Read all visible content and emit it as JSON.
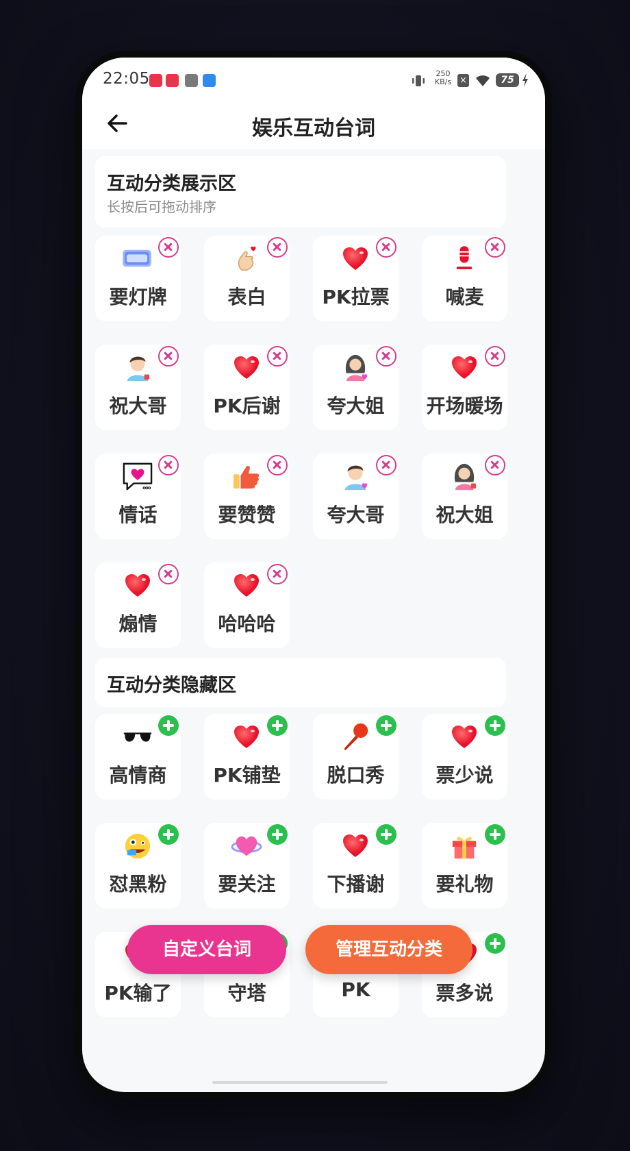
{
  "status_bar": {
    "time": "22:05",
    "net_speed_value": "250",
    "net_speed_unit": "KB/s",
    "battery": "75"
  },
  "header": {
    "title": "娱乐互动台词"
  },
  "shown_section": {
    "title": "互动分类展示区",
    "subtitle": "长按后可拖动排序",
    "items": [
      {
        "label": "要灯牌",
        "icon": "fan-club-badge-icon"
      },
      {
        "label": "表白",
        "icon": "finger-heart-icon"
      },
      {
        "label": "PK拉票",
        "icon": "heart-icon"
      },
      {
        "label": "喊麦",
        "icon": "microphone-icon"
      },
      {
        "label": "祝大哥",
        "icon": "man-thumbs-up-icon"
      },
      {
        "label": "PK后谢",
        "icon": "heart-icon"
      },
      {
        "label": "夸大姐",
        "icon": "woman-heart-icon"
      },
      {
        "label": "开场暖场",
        "icon": "heart-icon"
      },
      {
        "label": "情话",
        "icon": "heart-speech-bubble-icon"
      },
      {
        "label": "要赞赞",
        "icon": "thumbs-up-icon"
      },
      {
        "label": "夸大哥",
        "icon": "man-heart-icon"
      },
      {
        "label": "祝大姐",
        "icon": "woman-thumbs-up-icon"
      },
      {
        "label": "煽情",
        "icon": "heart-icon"
      },
      {
        "label": "哈哈哈",
        "icon": "heart-icon"
      }
    ]
  },
  "hidden_section": {
    "title": "互动分类隐藏区",
    "items": [
      {
        "label": "高情商",
        "icon": "sunglasses-icon"
      },
      {
        "label": "PK铺垫",
        "icon": "heart-icon"
      },
      {
        "label": "脱口秀",
        "icon": "karaoke-mic-icon"
      },
      {
        "label": "票少说",
        "icon": "heart-icon"
      },
      {
        "label": "怼黑粉",
        "icon": "crazy-face-icon"
      },
      {
        "label": "要关注",
        "icon": "heart-orbit-icon"
      },
      {
        "label": "下播谢",
        "icon": "heart-icon"
      },
      {
        "label": "要礼物",
        "icon": "gift-icon"
      },
      {
        "label": "PK输了",
        "icon": "heart-icon"
      },
      {
        "label": "守塔",
        "icon": "heart-icon"
      },
      {
        "label": "PK",
        "icon": "heart-icon"
      },
      {
        "label": "票多说",
        "icon": "heart-icon"
      }
    ]
  },
  "actions": {
    "custom_lines": "自定义台词",
    "manage_categories": "管理互动分类"
  },
  "colors": {
    "remove": "#d63b8f",
    "add": "#2bbf4e",
    "fab_pink": "#e9358f",
    "fab_orange": "#f46a3a",
    "heart": "#f0283c"
  }
}
